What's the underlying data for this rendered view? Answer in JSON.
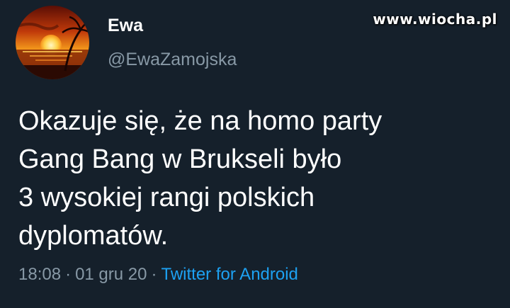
{
  "author": {
    "display_name": "Ewa",
    "handle": "@EwaZamojska"
  },
  "watermark": "www.wiocha.pl",
  "tweet": {
    "lines": [
      "Okazuje się, że na homo party",
      "Gang Bang w Brukseli było",
      "3 wysokiej rangi polskich",
      "dyplomatów."
    ]
  },
  "meta": {
    "time": "18:08",
    "separator": "·",
    "date": "01 gru 20",
    "source": "Twitter for Android"
  },
  "colors": {
    "background": "#15202b",
    "secondary_text": "#8899a6",
    "link": "#1da1f2"
  }
}
